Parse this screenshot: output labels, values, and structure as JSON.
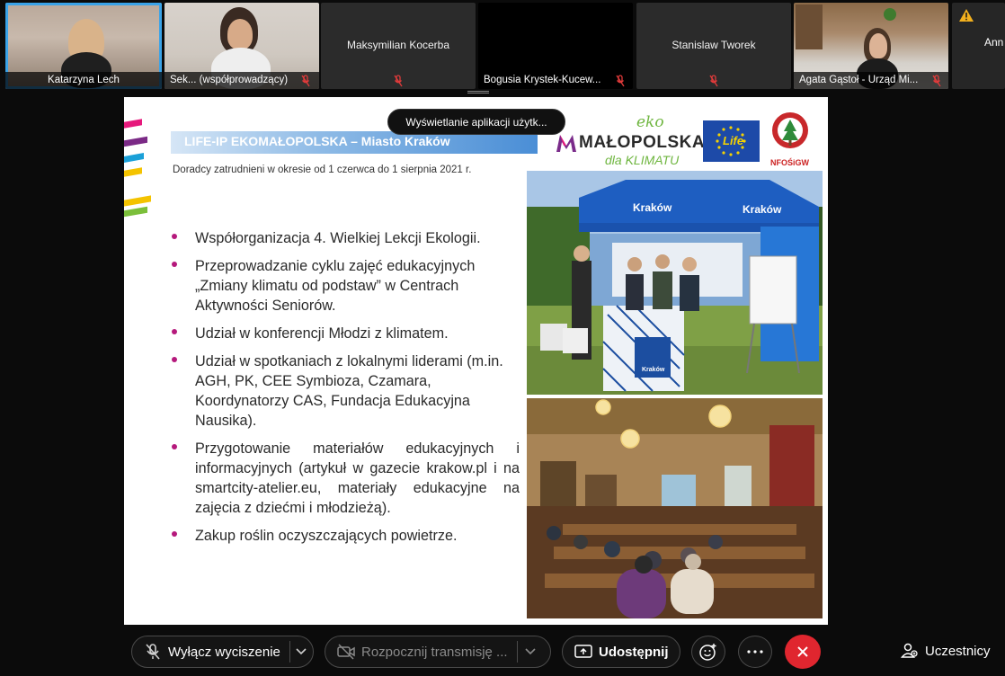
{
  "participants": [
    {
      "name": "Katarzyna Lech",
      "active": true
    },
    {
      "name": "Sek...  (współprowadzący)",
      "muted": true
    },
    {
      "name": "Maksymilian Kocerba",
      "muted": true
    },
    {
      "name": "Bogusia Krystek-Kucew...",
      "muted": true
    },
    {
      "name": "Stanislaw Tworek",
      "muted": true
    },
    {
      "name": "Agata Gąstoł - Urząd Mi...",
      "muted": true
    },
    {
      "name": "Ann"
    }
  ],
  "notice": {
    "icon": "warning-icon",
    "color": "#f2b01e"
  },
  "tooltip": "Wyświetlanie aplikacji użytk...",
  "slide": {
    "title": "LIFE-IP EKOMAŁOPOLSKA – Miasto Kraków",
    "subtitle": "Doradcy zatrudnieni w okresie od 1 czerwca do 1 sierpnia 2021 r.",
    "bullets": [
      "Współorganizacja 4. Wielkiej Lekcji Ekologii.",
      "Przeprowadzanie cyklu zajęć edukacyjnych „Zmiany klimatu od podstaw” w Centrach Aktywności Seniorów.",
      "Udział w konferencji Młodzi z klimatem.",
      "Udział w spotkaniach z lokalnymi liderami (m.in. AGH, PK, CEE Symbioza, Czamara, Koordynatorzy CAS, Fundacja Edukacyjna Nausika).",
      "Przygotowanie materiałów edukacyjnych i informacyjnych (artykuł w gazecie krakow.pl i na smartcity-atelier.eu, materiały edukacyjne na zajęcia z dziećmi i młodzieżą).",
      "Zakup roślin oczyszczających powietrze."
    ],
    "logos": {
      "eko": "eko",
      "malopolska": "MAŁOPOLSKA",
      "dla_klimatu": "dla KLIMATU",
      "life": "Life",
      "nfosigw": "NFOŚiGW"
    },
    "photo_text": {
      "tent": "Kraków",
      "booth": "Kraków"
    },
    "bullet_color": "#b5197c"
  },
  "toolbar": {
    "noise": "Wyłącz wyciszenie",
    "video": "Rozpocznij transmisję ...",
    "share": "Udostępnij",
    "participants": "Uczestnicy",
    "end_color": "#e0262f"
  }
}
